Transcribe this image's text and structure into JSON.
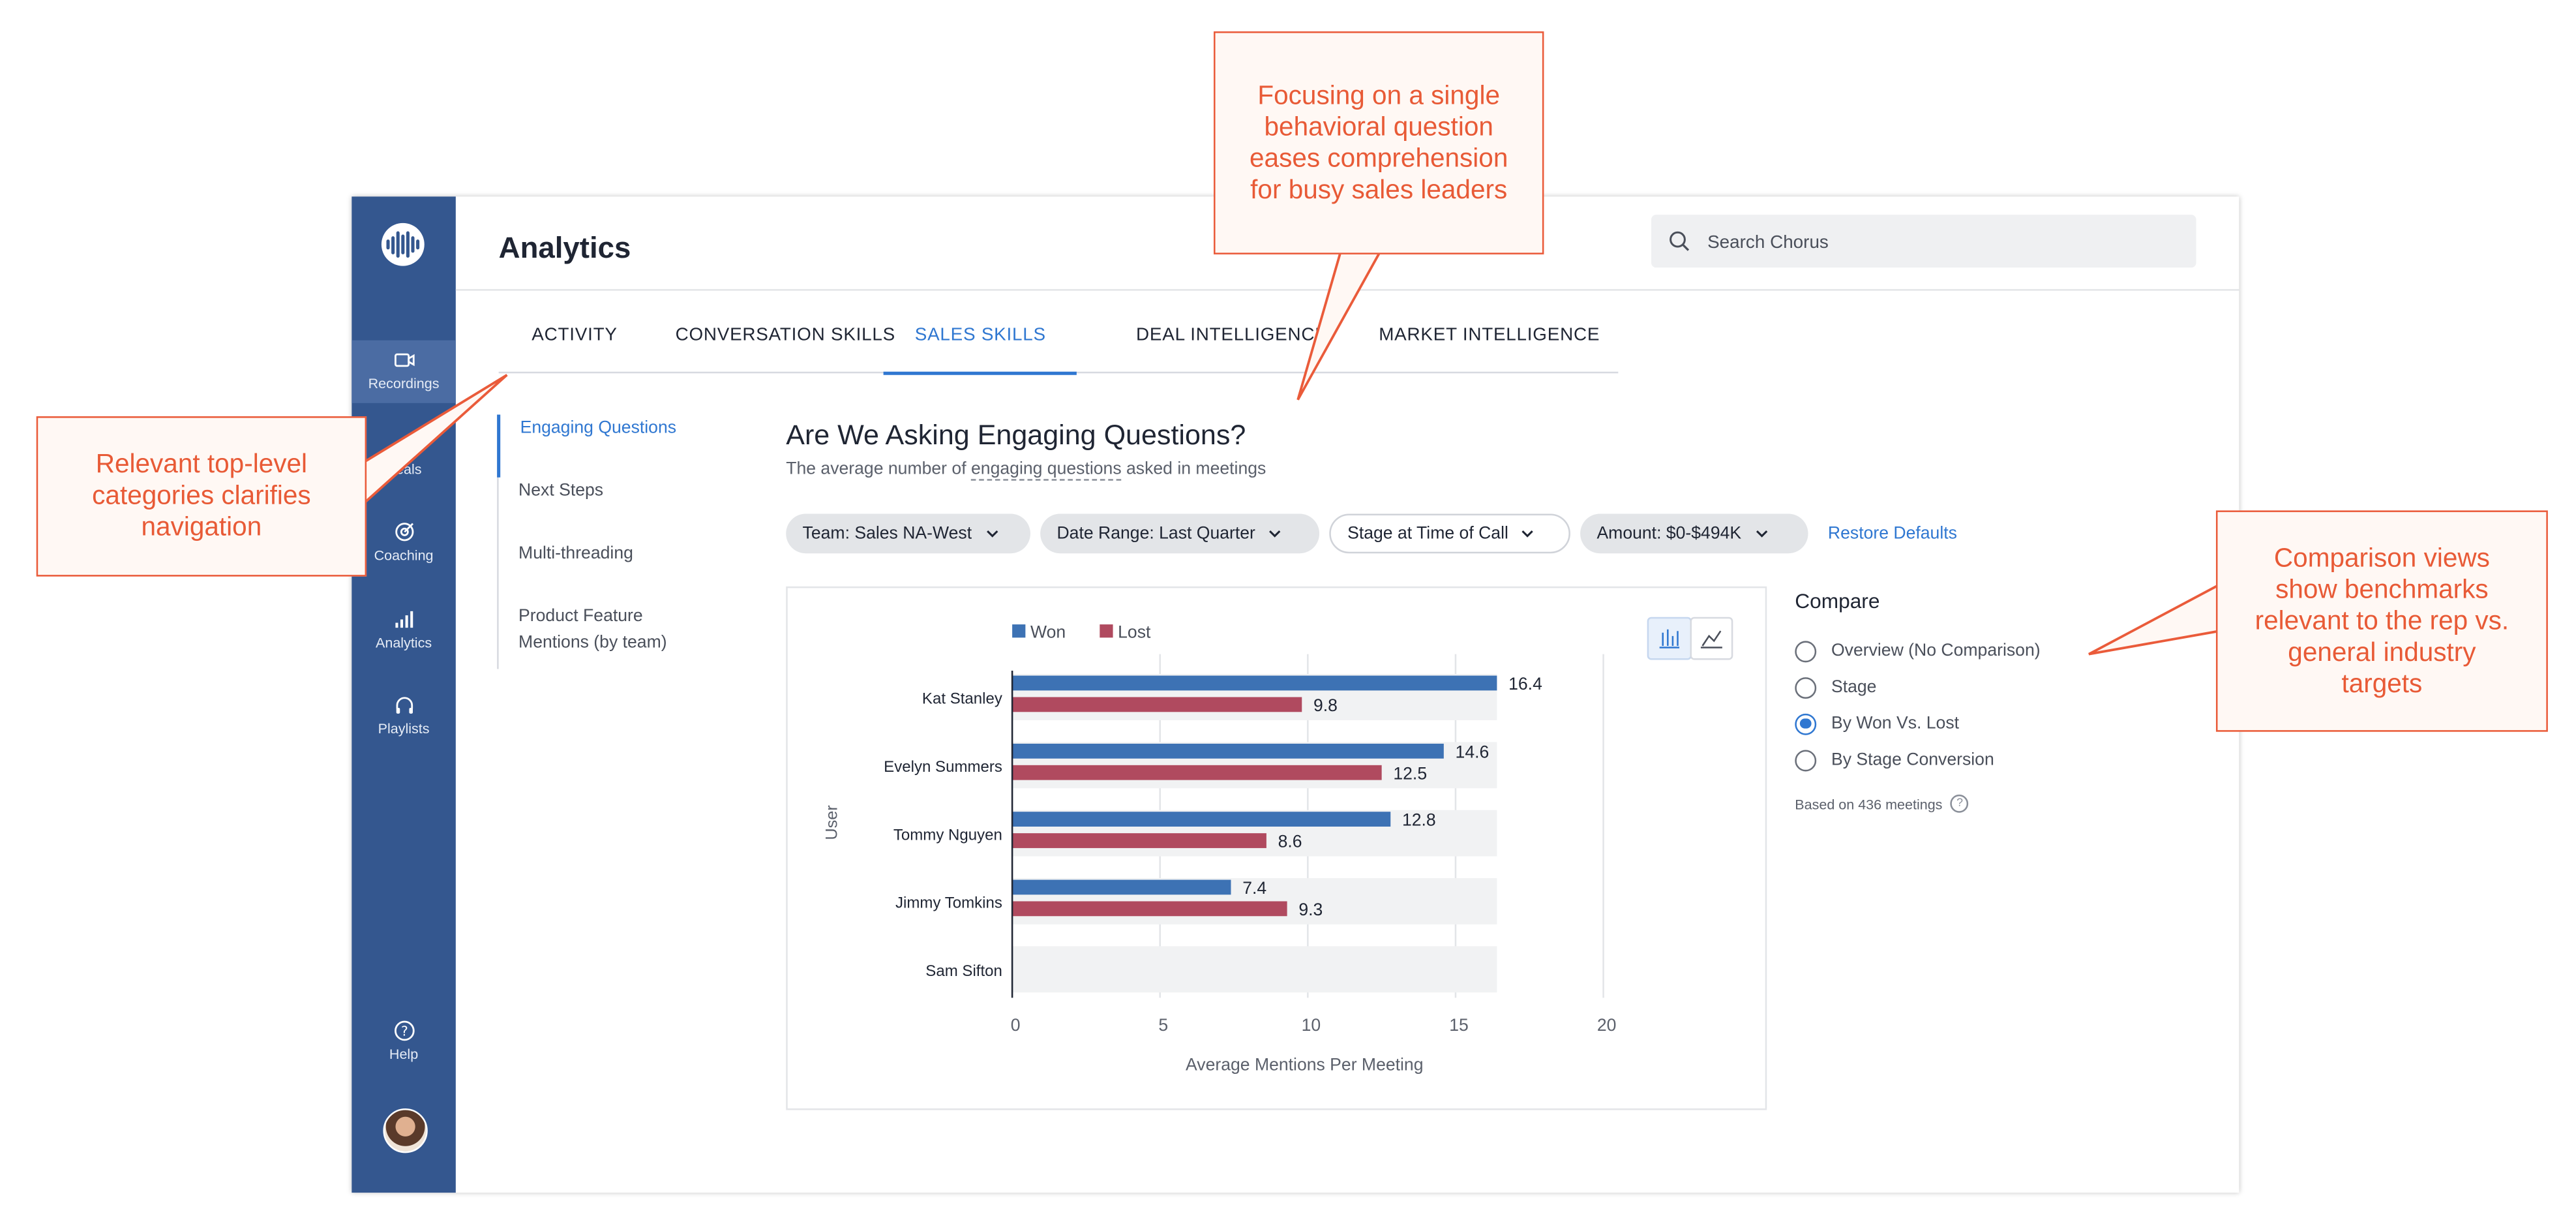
{
  "app": {
    "title": "Analytics"
  },
  "search": {
    "placeholder": "Search Chorus"
  },
  "sidebar": {
    "items": [
      {
        "label": "Recordings",
        "icon": "video-icon"
      },
      {
        "label": "Deals",
        "icon": "dollar-icon"
      },
      {
        "label": "Coaching",
        "icon": "target-icon"
      },
      {
        "label": "Analytics",
        "icon": "bars-icon"
      },
      {
        "label": "Playlists",
        "icon": "headphones-icon"
      }
    ],
    "help": "Help"
  },
  "tabs": [
    "ACTIVITY",
    "CONVERSATION SKILLS",
    "SALES SKILLS",
    "DEAL INTELLIGENCE",
    "MARKET INTELLIGENCE"
  ],
  "active_tab": "SALES SKILLS",
  "subnav": [
    "Engaging Questions",
    "Next Steps",
    "Multi-threading",
    "Product Feature Mentions (by team)"
  ],
  "main": {
    "title": "Are We Asking Engaging Questions?",
    "subtitle_pre": "The average number of",
    "subtitle_link": "engaging questions",
    "subtitle_post": "asked in meetings"
  },
  "filters": {
    "team": "Team: Sales NA-West",
    "date": "Date Range: Last Quarter",
    "stage": "Stage at Time of Call",
    "amount": "Amount: $0-$494K",
    "restore": "Restore Defaults"
  },
  "compare": {
    "title": "Compare",
    "options": [
      "Overview (No Comparison)",
      "Stage",
      "By Won Vs. Lost",
      "By Stage Conversion"
    ],
    "selected": "By Won Vs. Lost",
    "basis": "Based on 436 meetings"
  },
  "chart_data": {
    "type": "bar",
    "orientation": "horizontal",
    "categories": [
      "Kat Stanley",
      "Evelyn Summers",
      "Tommy Nguyen",
      "Jimmy Tomkins",
      "Sam Sifton"
    ],
    "series": [
      {
        "name": "Won",
        "values": [
          16.4,
          14.6,
          12.8,
          7.4,
          null
        ],
        "color": "#3d72b4"
      },
      {
        "name": "Lost",
        "values": [
          9.8,
          12.5,
          8.6,
          9.3,
          null
        ],
        "color": "#b04a5f"
      }
    ],
    "xlabel": "Average Mentions Per Meeting",
    "ylabel": "User",
    "xlim": [
      0,
      20
    ],
    "xticks": [
      0,
      5,
      10,
      15,
      20
    ],
    "grid": true,
    "legend": "top-left"
  },
  "callouts": {
    "top": "Focusing on a single behavioral question eases comprehension for busy sales leaders",
    "left": "Relevant top-level categories clarifies navigation",
    "right": "Comparison views show benchmarks relevant to the rep vs. general industry targets"
  },
  "colors": {
    "sidebar": "#34578f",
    "accent": "#2f77d1",
    "callout": "#e85a36",
    "won": "#3d72b4",
    "lost": "#b04a5f"
  }
}
